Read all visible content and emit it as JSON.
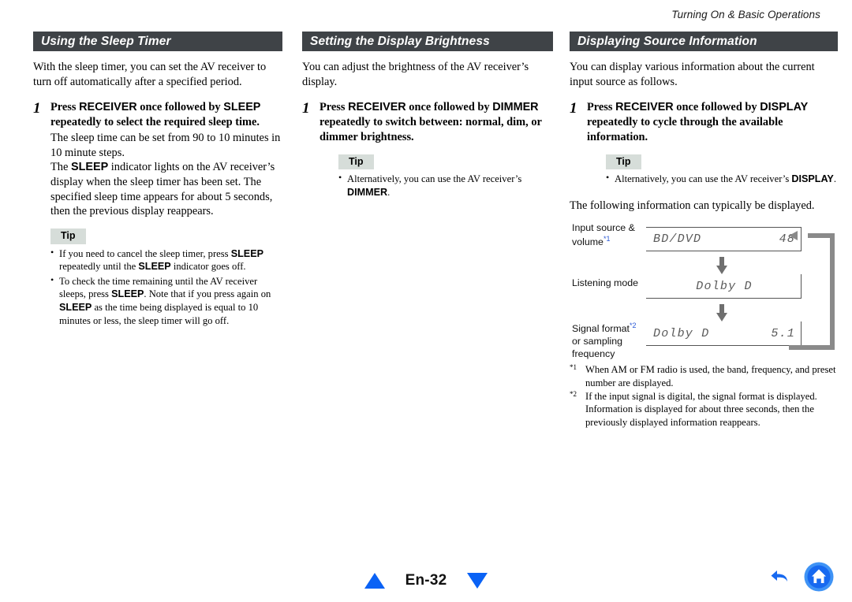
{
  "header": {
    "running_title": "Turning On & Basic Operations"
  },
  "columns": [
    {
      "id": "sleep-timer",
      "title": "Using the Sleep Timer",
      "intro": "With the sleep timer, you can set the AV receiver to turn off automatically after a specified period.",
      "step_number": "1",
      "step_title_parts": {
        "p1": "Press ",
        "b1": "RECEIVER",
        "p2": " once followed by ",
        "b2": "SLEEP",
        "p3": " repeatedly to select the required sleep time."
      },
      "step_texts": [
        "The sleep time can be set from 90 to 10 minutes in 10 minute steps."
      ],
      "step_text_rich": {
        "a1": "The ",
        "b1": "SLEEP",
        "a2": " indicator lights on the AV receiver’s display when the sleep timer has been set. The specified sleep time appears for about 5 seconds, then the previous display reappears."
      },
      "tip_label": "Tip",
      "tips": [
        {
          "a1": "If you need to cancel the sleep timer, press ",
          "b1": "SLEEP",
          "a2": " repeatedly until the ",
          "b2": "SLEEP",
          "a3": " indicator goes off."
        },
        {
          "a1": "To check the time remaining until the AV receiver sleeps, press ",
          "b1": "SLEEP",
          "a2": ". Note that if you press again on ",
          "b2": "SLEEP",
          "a3": " as the time being displayed is equal to 10 minutes or less, the sleep timer will go off."
        }
      ]
    },
    {
      "id": "display-brightness",
      "title": "Setting the Display Brightness",
      "intro": "You can adjust the brightness of the AV receiver’s display.",
      "step_number": "1",
      "step_title_parts": {
        "p1": "Press ",
        "b1": "RECEIVER",
        "p2": " once followed by ",
        "b2": "DIMMER",
        "p3": " repeatedly to switch between: normal, dim, or dimmer brightness."
      },
      "tip_label": "Tip",
      "tips": [
        {
          "a1": "Alternatively, you can use the AV receiver’s ",
          "b1": "DIMMER",
          "a2": "."
        }
      ]
    },
    {
      "id": "source-information",
      "title": "Displaying Source Information",
      "intro": "You can display various information about the current input source as follows.",
      "step_number": "1",
      "step_title_parts": {
        "p1": "Press ",
        "b1": "RECEIVER",
        "p2": " once followed by ",
        "b2": "DISPLAY",
        "p3": " repeatedly to cycle through the available information."
      },
      "tip_label": "Tip",
      "tips": [
        {
          "a1": "Alternatively, you can use the AV receiver’s ",
          "b1": "DISPLAY",
          "a2": "."
        }
      ],
      "flow_intro": "The following information can typically be displayed.",
      "flow_steps": [
        {
          "label_line1": "Input source &",
          "label_line2": "volume",
          "footnote_mark": "*1",
          "display_left": "BD/DVD",
          "display_right": "48",
          "display_center": ""
        },
        {
          "label_line1": "Listening mode",
          "label_line2": "",
          "footnote_mark": "",
          "display_left": "",
          "display_right": "",
          "display_center": "Dolby D"
        },
        {
          "label_line1": "Signal format",
          "label_line2": "or sampling",
          "label_line3": "frequency",
          "footnote_mark": "*2",
          "display_left": "Dolby D",
          "display_right": "5.1",
          "display_center": ""
        }
      ],
      "footnotes": [
        {
          "key": "*1",
          "text": "When AM or FM radio is used, the band, frequency, and preset number are displayed."
        },
        {
          "key": "*2",
          "text": "If the input signal is digital, the signal format is displayed. Information is displayed for about three seconds, then the previously displayed information reappears."
        }
      ]
    }
  ],
  "footer": {
    "page_label": "En-32",
    "prev_icon": "triangle-up-icon",
    "next_icon": "triangle-down-icon",
    "back_icon": "back-arrow-icon",
    "home_icon": "home-icon",
    "accent_color": "#0a62f5"
  }
}
